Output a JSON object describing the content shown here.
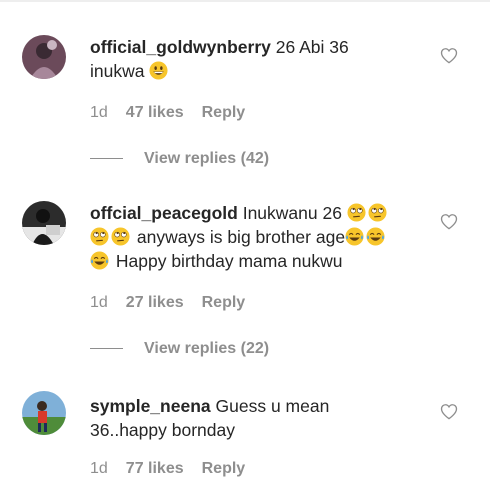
{
  "comments": [
    {
      "username": "official_goldwynberry",
      "text_lines": [
        "26 Abi 36",
        "inukwa"
      ],
      "age": "1d",
      "likes": "47 likes",
      "reply": "Reply",
      "view_replies": "View replies (42)"
    },
    {
      "username": "offcial_peacegold",
      "text_line1": "Inukwanu 26",
      "text_line2": "anyways is big brother age",
      "text_line3": "Happy birthday mama nukwu",
      "age": "1d",
      "likes": "27 likes",
      "reply": "Reply",
      "view_replies": "View replies (22)"
    },
    {
      "username": "symple_neena",
      "text_line1": "Guess u mean",
      "text_line2": "36..happy bornday",
      "age": "1d",
      "likes": "77 likes",
      "reply": "Reply"
    }
  ],
  "icons": {
    "like": "heart-outline-icon",
    "emoji_grin": "grinning-face-emoji",
    "emoji_eyeroll": "face-with-rolling-eyes-emoji",
    "emoji_joy": "face-with-tears-of-joy-emoji"
  },
  "colors": {
    "text": "#262626",
    "secondary": "#8e8e8e"
  }
}
